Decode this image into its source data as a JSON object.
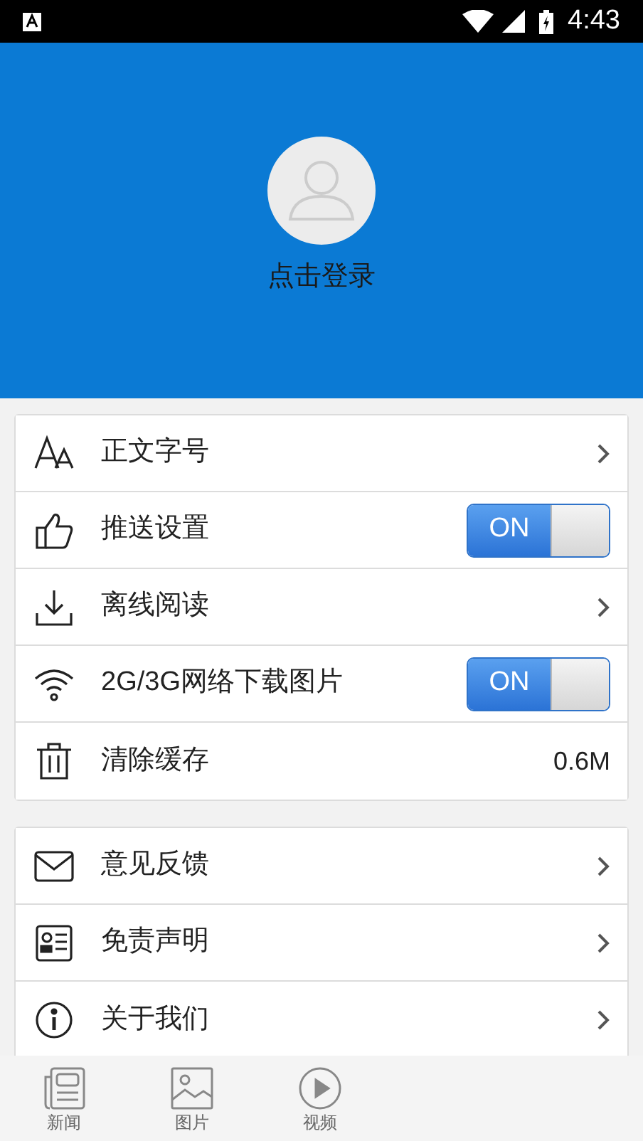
{
  "status_bar": {
    "time": "4:43"
  },
  "profile": {
    "login_label": "点击登录"
  },
  "settings_groups": [
    {
      "items": [
        {
          "label": "正文字号",
          "kind": "link"
        },
        {
          "label": "推送设置",
          "kind": "toggle",
          "on": true,
          "toggle_label": "ON"
        },
        {
          "label": "离线阅读",
          "kind": "link"
        },
        {
          "label": "2G/3G网络下载图片",
          "kind": "toggle",
          "on": true,
          "toggle_label": "ON"
        },
        {
          "label": "清除缓存",
          "kind": "value",
          "value": "0.6M"
        }
      ]
    },
    {
      "items": [
        {
          "label": "意见反馈",
          "kind": "link"
        },
        {
          "label": "免责声明",
          "kind": "link"
        },
        {
          "label": "关于我们",
          "kind": "link"
        }
      ]
    }
  ],
  "tab_bar": [
    {
      "label": "新闻"
    },
    {
      "label": "图片"
    },
    {
      "label": "视频"
    }
  ]
}
